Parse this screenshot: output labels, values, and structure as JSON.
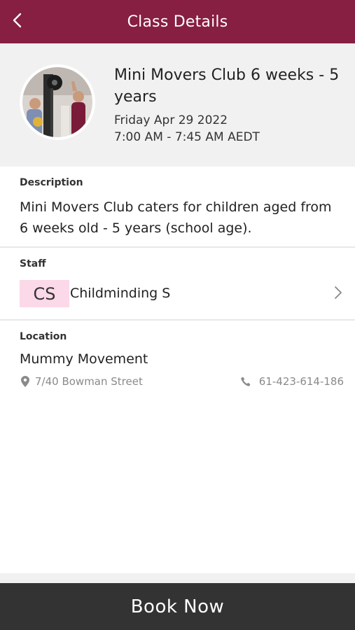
{
  "header": {
    "title": "Class Details",
    "back_icon": "chevron-left-icon",
    "background": "#861f41"
  },
  "class": {
    "name": "Mini Movers Club 6 weeks - 5 years",
    "date": "Friday Apr 29 2022",
    "time": "7:00 AM - 7:45 AM AEDT"
  },
  "description": {
    "label": "Description",
    "text": "Mini Movers Club caters for children aged from 6 weeks old - 5 years (school age)."
  },
  "staff": {
    "label": "Staff",
    "initials": "CS",
    "name": "Childminding S",
    "initials_bg": "#fcd9e8"
  },
  "location": {
    "label": "Location",
    "name": "Mummy Movement",
    "address": "7/40 Bowman Street",
    "phone": "61-423-614-186",
    "address_icon": "map-pin-icon",
    "phone_icon": "phone-icon"
  },
  "footer": {
    "book_label": "Book Now",
    "background": "#333333"
  }
}
